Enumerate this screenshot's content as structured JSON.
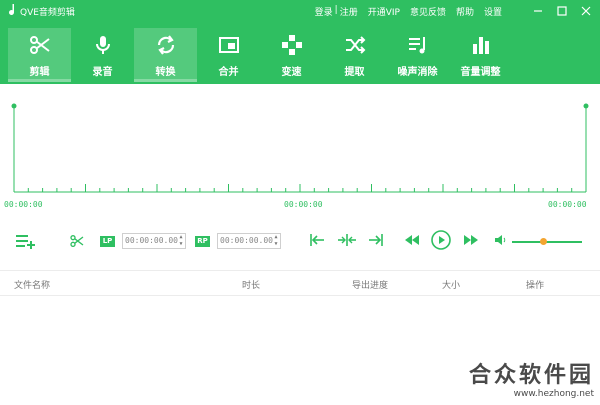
{
  "app": {
    "title": "QVE音频剪辑",
    "links": {
      "login": "登录",
      "sep": "|",
      "register": "注册",
      "vip": "开通VIP",
      "feedback": "意见反馈",
      "help": "帮助",
      "settings": "设置"
    }
  },
  "tools": [
    {
      "label": "剪辑",
      "icon": "scissors-icon",
      "active": true
    },
    {
      "label": "录音",
      "icon": "microphone-icon",
      "active": false
    },
    {
      "label": "转换",
      "icon": "convert-icon",
      "active": true
    },
    {
      "label": "合并",
      "icon": "merge-icon",
      "active": false
    },
    {
      "label": "变速",
      "icon": "speed-icon",
      "active": false
    },
    {
      "label": "提取",
      "icon": "extract-icon",
      "active": false
    },
    {
      "label": "噪声消除",
      "icon": "noise-icon",
      "active": false
    },
    {
      "label": "音量调整",
      "icon": "volume-bars-icon",
      "active": false
    }
  ],
  "timeline": {
    "start": "00:00:00",
    "middle": "00:00:00",
    "end": "00:00:00"
  },
  "controls": {
    "lp_label": "LP",
    "lp_time": "00:00:00.00",
    "rp_label": "RP",
    "rp_time": "00:00:00.00",
    "volume_level": 0.45
  },
  "file_list": {
    "columns": [
      "文件名称",
      "时长",
      "导出进度",
      "大小",
      "操作"
    ]
  },
  "watermark": {
    "main": "合众软件园",
    "sub": "www.hezhong.net"
  },
  "colors": {
    "accent": "#2fbf61",
    "knob": "#f3a531"
  }
}
